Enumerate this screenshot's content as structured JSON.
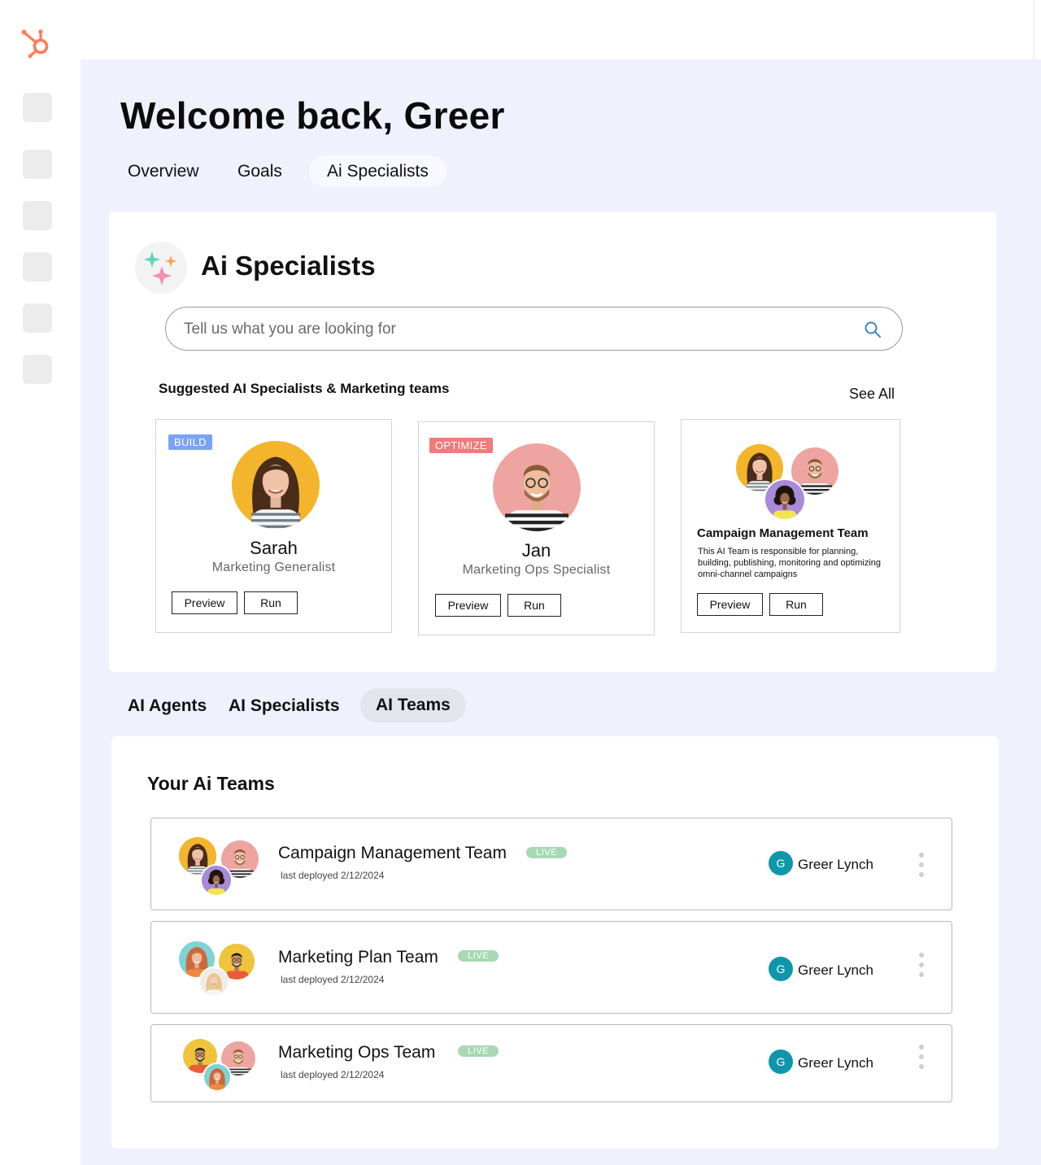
{
  "colors": {
    "brand": "#ff7a59",
    "main_bg": "#eff2fd",
    "build_badge": "#7aa2f7",
    "optimize_badge": "#f07b7b",
    "live_badge": "#a8d8b4",
    "owner_avatar": "#0f96ab"
  },
  "sidebar": {
    "logo_icon": "hubspot-sprocket-icon",
    "item_count": 6
  },
  "header": {
    "welcome": "Welcome back, Greer"
  },
  "main_tabs": [
    {
      "label": "Overview",
      "active": false
    },
    {
      "label": "Goals",
      "active": false
    },
    {
      "label": "Ai Specialists",
      "active": true
    }
  ],
  "specialists_panel": {
    "title": "Ai Specialists",
    "icon": "sparkle-icon",
    "search": {
      "placeholder": "Tell us what you are looking for",
      "value": "",
      "icon": "search-icon"
    },
    "suggested_heading": "Suggested AI Specialists & Marketing teams",
    "see_all": "See All",
    "cards": [
      {
        "badge": "BUILD",
        "name": "Sarah",
        "role": "Marketing Generalist",
        "preview": "Preview",
        "run": "Run"
      },
      {
        "badge": "OPTIMIZE",
        "name": "Jan",
        "role": "Marketing Ops Specialist",
        "preview": "Preview",
        "run": "Run"
      },
      {
        "name": "Campaign Management Team",
        "description": "This AI Team is responsible for planning, building, publishing, monitoring and optimizing omni-channel campaigns",
        "preview": "Preview",
        "run": "Run"
      }
    ]
  },
  "secondary_tabs": [
    {
      "label": "AI Agents",
      "active": false
    },
    {
      "label": "AI Specialists",
      "active": false
    },
    {
      "label": "AI Teams",
      "active": true
    }
  ],
  "teams_panel": {
    "title": "Your Ai Teams",
    "teams": [
      {
        "name": "Campaign Management Team",
        "status": "LIVE",
        "deployed": "last deployed 2/12/2024",
        "owner": "Greer Lynch",
        "owner_initial": "G"
      },
      {
        "name": "Marketing Plan Team",
        "status": "LIVE",
        "deployed": "last deployed 2/12/2024",
        "owner": "Greer Lynch",
        "owner_initial": "G"
      },
      {
        "name": "Marketing Ops Team",
        "status": "LIVE",
        "deployed": "last deployed 2/12/2024",
        "owner": "Greer Lynch",
        "owner_initial": "G"
      }
    ]
  }
}
